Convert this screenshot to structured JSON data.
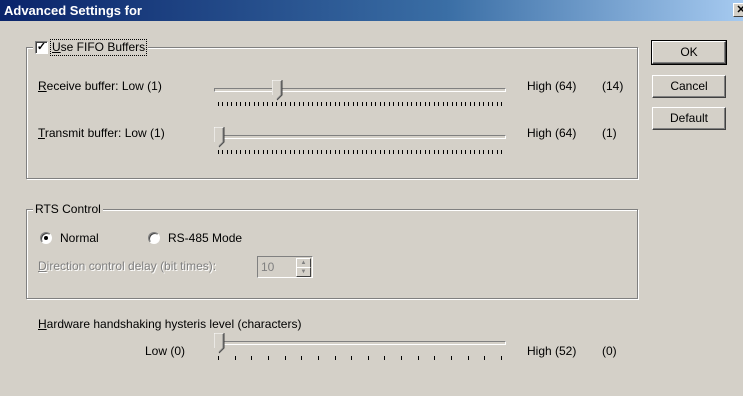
{
  "window": {
    "title": "Advanced Settings for",
    "close_glyph": "✕"
  },
  "fifo": {
    "checkbox_label": "Use FIFO Buffers",
    "checked": true,
    "receive": {
      "label": "Receive buffer: Low (1)",
      "high_label": "High (64)",
      "value_text": "(14)",
      "value": 14,
      "min": 1,
      "max": 64
    },
    "transmit": {
      "label": "Transmit buffer: Low (1)",
      "high_label": "High (64)",
      "value_text": "(1)",
      "value": 1,
      "min": 1,
      "max": 64
    }
  },
  "rts": {
    "group_label": "RTS Control",
    "normal_label": "Normal",
    "rs485_label": "RS-485 Mode",
    "selected": "normal",
    "delay_label": "Direction control delay (bit times):",
    "delay_value": "10"
  },
  "hysteresis": {
    "label": "Hardware handshaking hysteris level (characters)",
    "low_label": "Low (0)",
    "high_label": "High (52)",
    "value_text": "(0)",
    "value": 0,
    "min": 0,
    "max": 52
  },
  "buttons": {
    "ok": "OK",
    "cancel": "Cancel",
    "default": "Default"
  }
}
